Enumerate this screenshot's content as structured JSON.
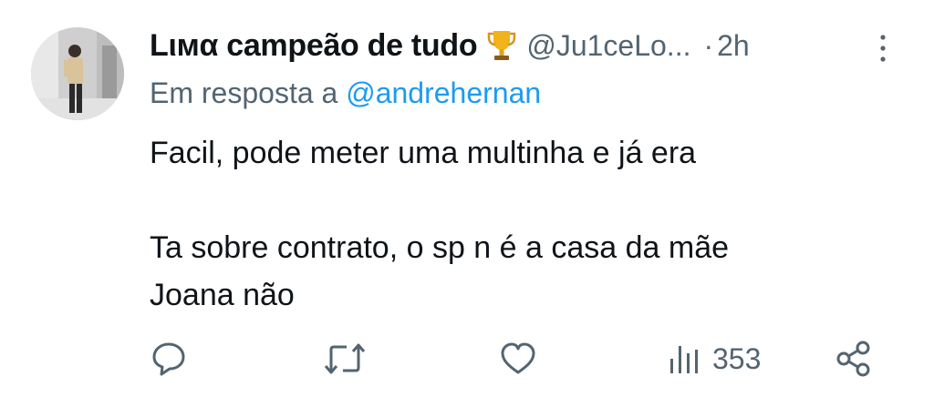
{
  "author": {
    "display_name": "Lιмα campeão de tudo",
    "handle": "@Ju1ceLo...",
    "separator": "·",
    "time": "2h",
    "badge_icon": "trophy-icon"
  },
  "reply": {
    "prefix": "Em resposta a",
    "mention": "@andrehernan"
  },
  "body": {
    "line1": "Facil, pode meter uma multinha e já era",
    "line2": "",
    "line3": "Ta sobre contrato, o sp n é a casa da mãe",
    "line4": "Joana não"
  },
  "actions": {
    "reply_icon": "comment-icon",
    "retweet_icon": "retweet-icon",
    "like_icon": "heart-icon",
    "views_icon": "bar-chart-icon",
    "views_count": "353",
    "share_icon": "share-icon"
  },
  "colors": {
    "text": "#0f1419",
    "secondary": "#536471",
    "link": "#1d9bf0",
    "background": "#ffffff"
  }
}
